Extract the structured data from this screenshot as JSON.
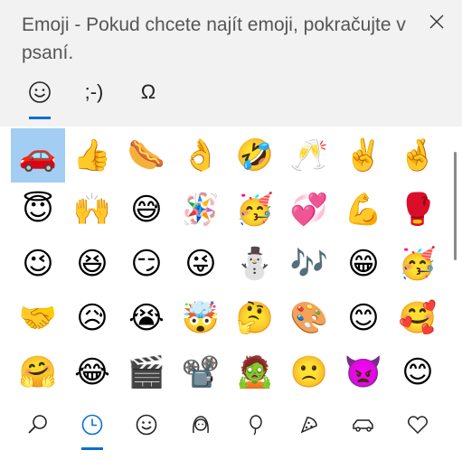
{
  "header": {
    "hint_text": "Emoji - Pokud chcete najít emoji, pokračujte v psaní."
  },
  "tabs": [
    {
      "label": "☺",
      "name": "emoji-tab"
    },
    {
      "label": ";-)",
      "name": "kaomoji-tab"
    },
    {
      "label": "Ω",
      "name": "symbols-tab"
    }
  ],
  "emojis": [
    "🚗",
    "👍",
    "🌭",
    "👌",
    "🤣",
    "🥂",
    "✌️",
    "🤞",
    "😇",
    "🙌",
    "😅",
    "🪅",
    "🥳",
    "💞",
    "💪",
    "🥊",
    "😉",
    "😆",
    "😏",
    "😜",
    "⛄",
    "🎶",
    "😁",
    "🥳",
    "🤝",
    "😥",
    "😭",
    "🤯",
    "🤔",
    "🎨",
    "😊",
    "🥰",
    "🤗",
    "😂",
    "🎬",
    "📽️",
    "🧟",
    "🙁",
    "👿",
    "😊"
  ],
  "categories": [
    {
      "icon": "search-icon"
    },
    {
      "icon": "recent-icon"
    },
    {
      "icon": "smiley-icon"
    },
    {
      "icon": "people-icon"
    },
    {
      "icon": "balloon-icon"
    },
    {
      "icon": "food-icon"
    },
    {
      "icon": "car-icon"
    },
    {
      "icon": "heart-icon"
    }
  ],
  "colors": {
    "accent": "#0a6fd1",
    "selection": "#a3cdf2",
    "header_bg": "#f2f2f2"
  }
}
